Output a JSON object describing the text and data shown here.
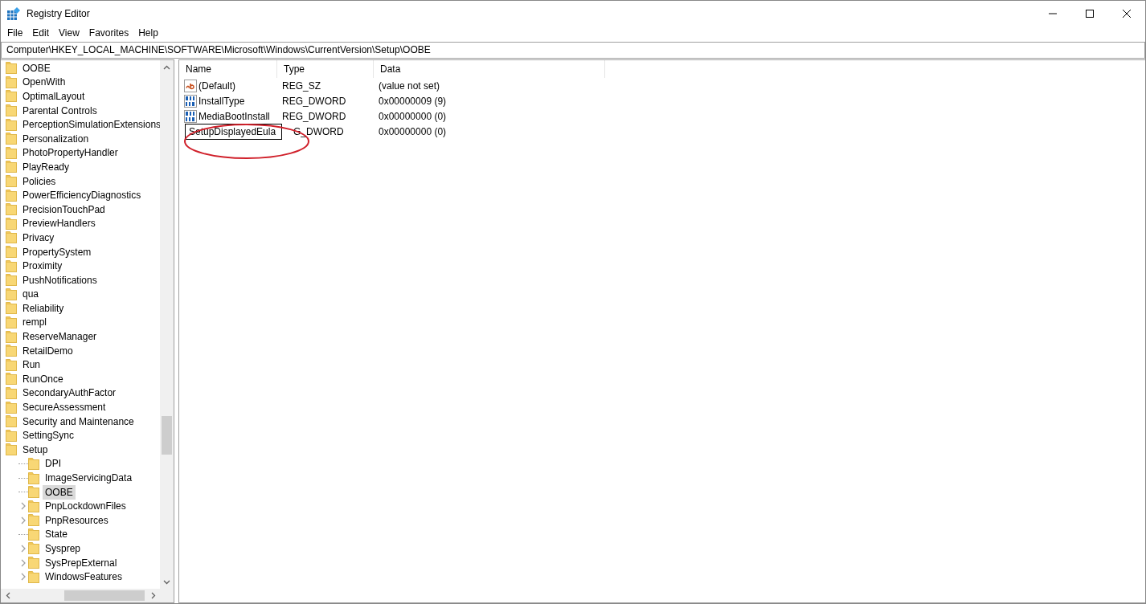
{
  "window": {
    "title": "Registry Editor"
  },
  "menu": [
    "File",
    "Edit",
    "View",
    "Favorites",
    "Help"
  ],
  "address": "Computer\\HKEY_LOCAL_MACHINE\\SOFTWARE\\Microsoft\\Windows\\CurrentVersion\\Setup\\OOBE",
  "tree": [
    {
      "label": "OOBE",
      "selected": false
    },
    {
      "label": "OpenWith",
      "selected": false
    },
    {
      "label": "OptimalLayout",
      "selected": false
    },
    {
      "label": "Parental Controls",
      "selected": false
    },
    {
      "label": "PerceptionSimulationExtensions",
      "selected": false
    },
    {
      "label": "Personalization",
      "selected": false
    },
    {
      "label": "PhotoPropertyHandler",
      "selected": false
    },
    {
      "label": "PlayReady",
      "selected": false
    },
    {
      "label": "Policies",
      "selected": false
    },
    {
      "label": "PowerEfficiencyDiagnostics",
      "selected": false
    },
    {
      "label": "PrecisionTouchPad",
      "selected": false
    },
    {
      "label": "PreviewHandlers",
      "selected": false
    },
    {
      "label": "Privacy",
      "selected": false
    },
    {
      "label": "PropertySystem",
      "selected": false
    },
    {
      "label": "Proximity",
      "selected": false
    },
    {
      "label": "PushNotifications",
      "selected": false
    },
    {
      "label": "qua",
      "selected": false
    },
    {
      "label": "Reliability",
      "selected": false
    },
    {
      "label": "rempl",
      "selected": false
    },
    {
      "label": "ReserveManager",
      "selected": false
    },
    {
      "label": "RetailDemo",
      "selected": false
    },
    {
      "label": "Run",
      "selected": false
    },
    {
      "label": "RunOnce",
      "selected": false
    },
    {
      "label": "SecondaryAuthFactor",
      "selected": false
    },
    {
      "label": "SecureAssessment",
      "selected": false
    },
    {
      "label": "Security and Maintenance",
      "selected": false
    },
    {
      "label": "SettingSync",
      "selected": false
    },
    {
      "label": "Setup",
      "selected": false,
      "children": [
        {
          "label": "DPI",
          "selected": false,
          "expandable": false
        },
        {
          "label": "ImageServicingData",
          "selected": false,
          "expandable": false
        },
        {
          "label": "OOBE",
          "selected": true,
          "expandable": false
        },
        {
          "label": "PnpLockdownFiles",
          "selected": false,
          "expandable": true
        },
        {
          "label": "PnpResources",
          "selected": false,
          "expandable": true
        },
        {
          "label": "State",
          "selected": false,
          "expandable": false
        },
        {
          "label": "Sysprep",
          "selected": false,
          "expandable": true
        },
        {
          "label": "SysPrepExternal",
          "selected": false,
          "expandable": true
        },
        {
          "label": "WindowsFeatures",
          "selected": false,
          "expandable": true
        }
      ]
    }
  ],
  "columns": [
    "Name",
    "Type",
    "Data"
  ],
  "values": [
    {
      "kind": "string",
      "name": "(Default)",
      "type": "REG_SZ",
      "data": "(value not set)",
      "editing": false
    },
    {
      "kind": "binary",
      "name": "InstallType",
      "type": "REG_DWORD",
      "data": "0x00000009 (9)",
      "editing": false
    },
    {
      "kind": "binary",
      "name": "MediaBootInstall",
      "type": "REG_DWORD",
      "data": "0x00000000 (0)",
      "editing": false
    },
    {
      "kind": "binary",
      "name": "SetupDisplayedEula",
      "type": "G_DWORD",
      "data": "0x00000000 (0)",
      "editing": true
    }
  ]
}
